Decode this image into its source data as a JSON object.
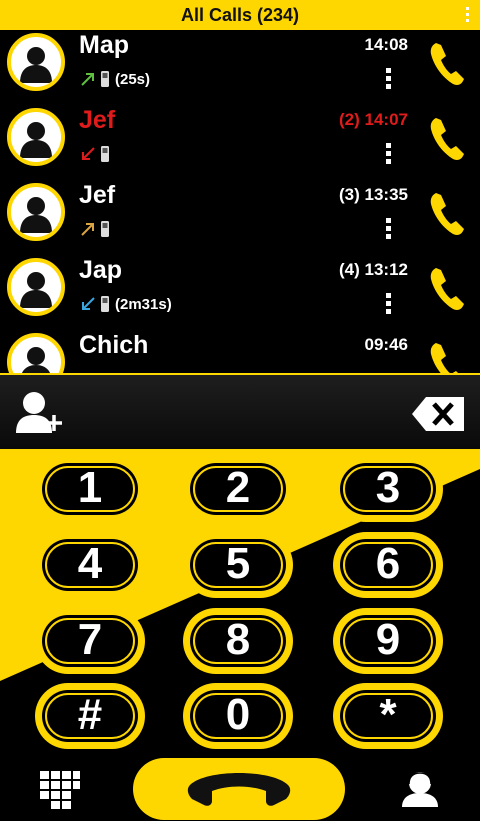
{
  "header": {
    "title": "All Calls (234)"
  },
  "calls": [
    {
      "name": "Map",
      "time": "14:08",
      "duration": "(25s)",
      "direction": "outgoing",
      "missed": false
    },
    {
      "name": "Jef",
      "time": "(2) 14:07",
      "duration": "",
      "direction": "missed",
      "missed": true
    },
    {
      "name": "Jef",
      "time": "(3) 13:35",
      "duration": "",
      "direction": "outgoing-unanswered",
      "missed": false
    },
    {
      "name": "Jap",
      "time": "(4) 13:12",
      "duration": "(2m31s)",
      "direction": "incoming",
      "missed": false
    },
    {
      "name": "Chich",
      "time": "09:46",
      "duration": "",
      "direction": "outgoing",
      "missed": false
    }
  ],
  "keypad": {
    "keys": [
      "1",
      "2",
      "3",
      "4",
      "5",
      "6",
      "7",
      "8",
      "9",
      "#",
      "0",
      "*"
    ]
  },
  "colors": {
    "accent": "#ffd700",
    "missed": "#e01b1b",
    "outgoing_arrow": "#5fbf3f",
    "incoming_arrow": "#39a7e0",
    "unanswered_arrow": "#d9a441"
  },
  "icons": {
    "add_contact": "add-contact-icon",
    "backspace": "backspace-icon",
    "keypad": "keypad-grid-icon",
    "call": "phone-handset-icon",
    "contact": "contact-icon"
  }
}
